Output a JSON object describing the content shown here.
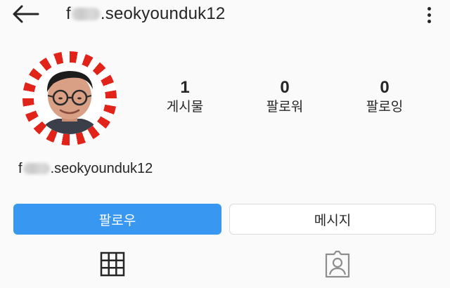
{
  "header": {
    "username_prefix": "f",
    "username_suffix": ".seokyounduk12"
  },
  "profile": {
    "avatar_alt": "profile-photo",
    "name_prefix": "f",
    "name_suffix": ".seokyounduk12"
  },
  "stats": [
    {
      "value": "1",
      "label": "게시물"
    },
    {
      "value": "0",
      "label": "팔로워"
    },
    {
      "value": "0",
      "label": "팔로잉"
    }
  ],
  "actions": {
    "follow_label": "팔로우",
    "message_label": "메시지"
  },
  "tabs": {
    "grid_icon": "grid-icon",
    "tagged_icon": "tagged-person-icon"
  },
  "colors": {
    "accent": "#3897f0",
    "avatar_ring_red": "#e2231a",
    "avatar_ring_white": "#ffffff",
    "background": "#fafafa",
    "text": "#262626"
  }
}
